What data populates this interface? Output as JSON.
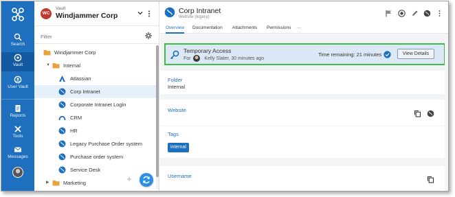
{
  "rail": {
    "items": [
      {
        "label": "Search"
      },
      {
        "label": "Vault"
      },
      {
        "label": "User Vault"
      },
      {
        "label": "Reports"
      },
      {
        "label": "Tools"
      },
      {
        "label": "Messages"
      }
    ]
  },
  "vault": {
    "badge": "WC",
    "small_label": "Vault",
    "name": "Windjammer Corp",
    "filter_placeholder": "Filter"
  },
  "tree": {
    "root": "Windjammer Corp",
    "folder": "Internal",
    "items": [
      "Atlassian",
      "Corp Intranet",
      "Corporate Intranet Login",
      "CRM",
      "HR",
      "Legacy Purchase Order system",
      "Purchase order system",
      "Service Desk"
    ],
    "next_folder": "Marketing"
  },
  "entry": {
    "title": "Corp Intranet",
    "subtitle": "Website (legacy)",
    "tabs": [
      "Overview",
      "Documentation",
      "Attachments",
      "Permissions",
      "···"
    ]
  },
  "banner": {
    "title": "Temporary Access",
    "for_label": "For",
    "for_text": "Kelly Slater, 30 minutes ago",
    "time_remaining": "Time remaining: 21 minutes",
    "button": "View Details"
  },
  "fields": {
    "folder_label": "Folder",
    "folder_value": "Internal",
    "website_label": "Website",
    "tags_label": "Tags",
    "tag": "internal",
    "username_label": "Username"
  },
  "colors": {
    "rail": "#1f6fbf",
    "accent": "#1f6fbf",
    "banner_border": "#3bbf46",
    "badge": "#c0392b"
  }
}
